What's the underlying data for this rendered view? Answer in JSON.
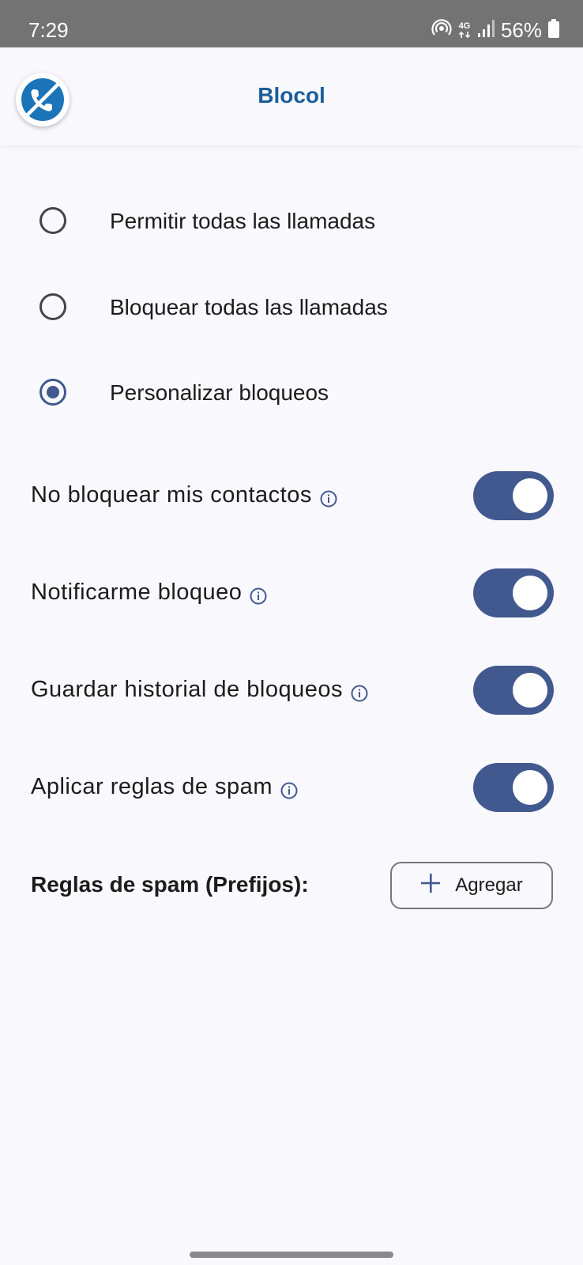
{
  "status_bar": {
    "time": "7:29",
    "network": "4G",
    "battery": "56%",
    "icons": [
      "hotspot-icon",
      "network-4g-icon",
      "signal-icon",
      "battery-icon"
    ]
  },
  "app_bar": {
    "title": "Blocol",
    "logo_icon": "blocked-call-icon"
  },
  "radio_options": [
    {
      "label": "Permitir todas las llamadas",
      "selected": false
    },
    {
      "label": "Bloquear todas las llamadas",
      "selected": false
    },
    {
      "label": "Personalizar bloqueos",
      "selected": true
    }
  ],
  "settings": [
    {
      "label": "No bloquear mis contactos",
      "enabled": true
    },
    {
      "label": "Notificarme bloqueo",
      "enabled": true
    },
    {
      "label": "Guardar historial de bloqueos",
      "enabled": true
    },
    {
      "label": "Aplicar reglas de spam",
      "enabled": true
    }
  ],
  "spam_rules": {
    "title": "Reglas de spam (Prefijos):",
    "add_label": "Agregar"
  },
  "colors": {
    "accent": "#42598f",
    "title": "#1b5e9b",
    "background": "#f8f8fd",
    "status_bar": "#737373"
  }
}
